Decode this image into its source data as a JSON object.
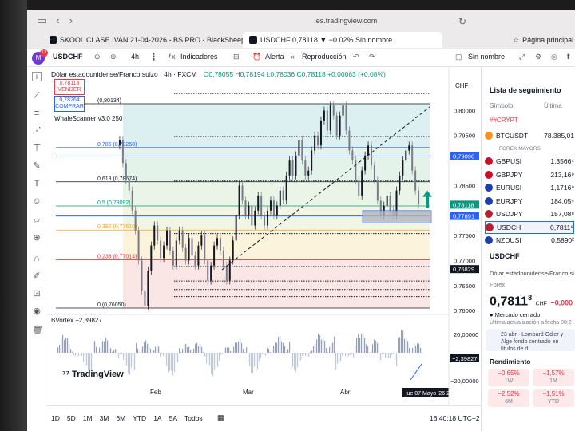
{
  "browser": {
    "url": "es.tradingview.com",
    "tabs": [
      {
        "label": "SKOOL CLASE IVAN 21-04-2026 - BS PRO - BlackSheep Academy"
      },
      {
        "label": "USDCHF 0,78118 ▼ −0.02% Sin nombre"
      },
      {
        "label": "Página principal"
      }
    ]
  },
  "toolbar": {
    "avatar": "M",
    "avatar_badge": "11",
    "symbol": "USDCHF",
    "interval": "4h",
    "indicators_label": "Indicadores",
    "alert_label": "Alerta",
    "replay_label": "Reproducción",
    "layout_name": "Sin nombre"
  },
  "legend": {
    "title": "Dólar estadounidense/Franco suizo · 4h · FXCM",
    "ohlc": "O0,78055 H0,78194 L0,78036 C0,78118 +0,00063 (+0,08%)",
    "indicator": "WhaleScanner v3.0 250"
  },
  "trade": {
    "sell_price": "0,78118",
    "sell_label": "VENDER",
    "buy_price": "0,78264",
    "buy_label": "COMPRAR"
  },
  "fib_levels": [
    {
      "label": "(0,80134)",
      "value": 0.80134
    },
    {
      "label": "0,786 (0,79260)",
      "value": 0.7926
    },
    {
      "label": "0,618 (0,78574)",
      "value": 0.78574
    },
    {
      "label": "0,5 (0,78092)",
      "value": 0.78092
    },
    {
      "label": "0,382 (0,77610)",
      "value": 0.7761
    },
    {
      "label": "0,236 (0,77014)",
      "value": 0.77014
    },
    {
      "label": "0 (0,76050)",
      "value": 0.7605
    }
  ],
  "price_axis": {
    "currency": "CHF",
    "ticks": [
      "0,80000",
      "0,79500",
      "0,78500",
      "0,77500",
      "0,77000",
      "0,76500",
      "0,76000"
    ],
    "markers": [
      {
        "value": "0,79090",
        "color": "#2962ff"
      },
      {
        "value": "0,78118",
        "color": "#089981"
      },
      {
        "value": "0,77891",
        "color": "#2962ff"
      },
      {
        "value": "0,76829",
        "color": "#131722"
      }
    ]
  },
  "oscillator": {
    "label": "BVortex",
    "value": "−2,39827",
    "ticks": [
      "20,00000",
      "−20,00000"
    ],
    "current": "−2,39827"
  },
  "time_axis": {
    "labels": [
      "Feb",
      "Mar",
      "Abr"
    ],
    "cursor_label": "jue 07 Mayo '26   23:00",
    "logo": "TradingView"
  },
  "bottom_bar": {
    "ranges": [
      "1D",
      "5D",
      "1M",
      "3M",
      "6M",
      "YTD",
      "1A",
      "5A",
      "Todos"
    ],
    "clock": "16:40:18 UTC+2"
  },
  "watchlist": {
    "title": "Lista de seguimiento",
    "col_symbol": "Símbolo",
    "col_last": "Última",
    "crypt_label": "##CRYPT",
    "section": "FOREX MAYORS",
    "items": [
      {
        "symbol": "BTCUSDT",
        "value": "78.385,01",
        "color": "#f7931a"
      },
      {
        "symbol": "GBPUSI",
        "value": "1,3566⁴",
        "color": "#c8102e"
      },
      {
        "symbol": "GBPJPY",
        "value": "213,16⁹",
        "color": "#c8102e"
      },
      {
        "symbol": "EURUSI",
        "value": "1,1716⁹",
        "color": "#1e3fa8"
      },
      {
        "symbol": "EURJPY",
        "value": "184,05⁴",
        "color": "#1e3fa8"
      },
      {
        "symbol": "USDJPY",
        "value": "157,08⁸",
        "color": "#b22234"
      },
      {
        "symbol": "USDCH",
        "value": "0,7811⁸",
        "color": "#b22234"
      },
      {
        "symbol": "NZDUSI",
        "value": "0,5890²",
        "color": "#1e3fa8"
      }
    ],
    "detail": {
      "symbol": "USDCHF",
      "name": "Dólar estadounidense/Franco suizo",
      "type": "Forex",
      "price_main": "0,7811",
      "price_sup": "8",
      "currency": "CHF",
      "change": "−0,000",
      "market": "Mercado cerrado",
      "updated": "Última actualización a fecha 00:2",
      "news": "23 abr · Lombard Odier y Alge fondo centrado en títulos de d"
    },
    "performance": {
      "title": "Rendimiento",
      "cells": [
        {
          "value": "−0,65%",
          "period": "1W"
        },
        {
          "value": "−1,57%",
          "period": "1M"
        },
        {
          "value": "−2,52%",
          "period": "6M"
        },
        {
          "value": "−1,51%",
          "period": "YTD"
        }
      ]
    }
  }
}
